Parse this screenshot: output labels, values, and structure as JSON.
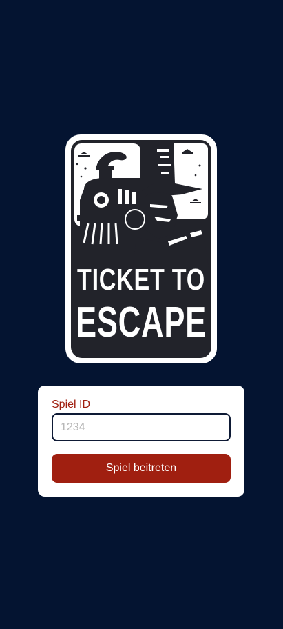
{
  "logo": {
    "line1": "TICKET TO",
    "line2": "ESCAPE"
  },
  "form": {
    "label": "Spiel ID",
    "placeholder": "1234",
    "value": "",
    "button_label": "Spiel beitreten"
  },
  "colors": {
    "background": "#041431",
    "accent": "#a01f10",
    "card": "#ffffff"
  }
}
